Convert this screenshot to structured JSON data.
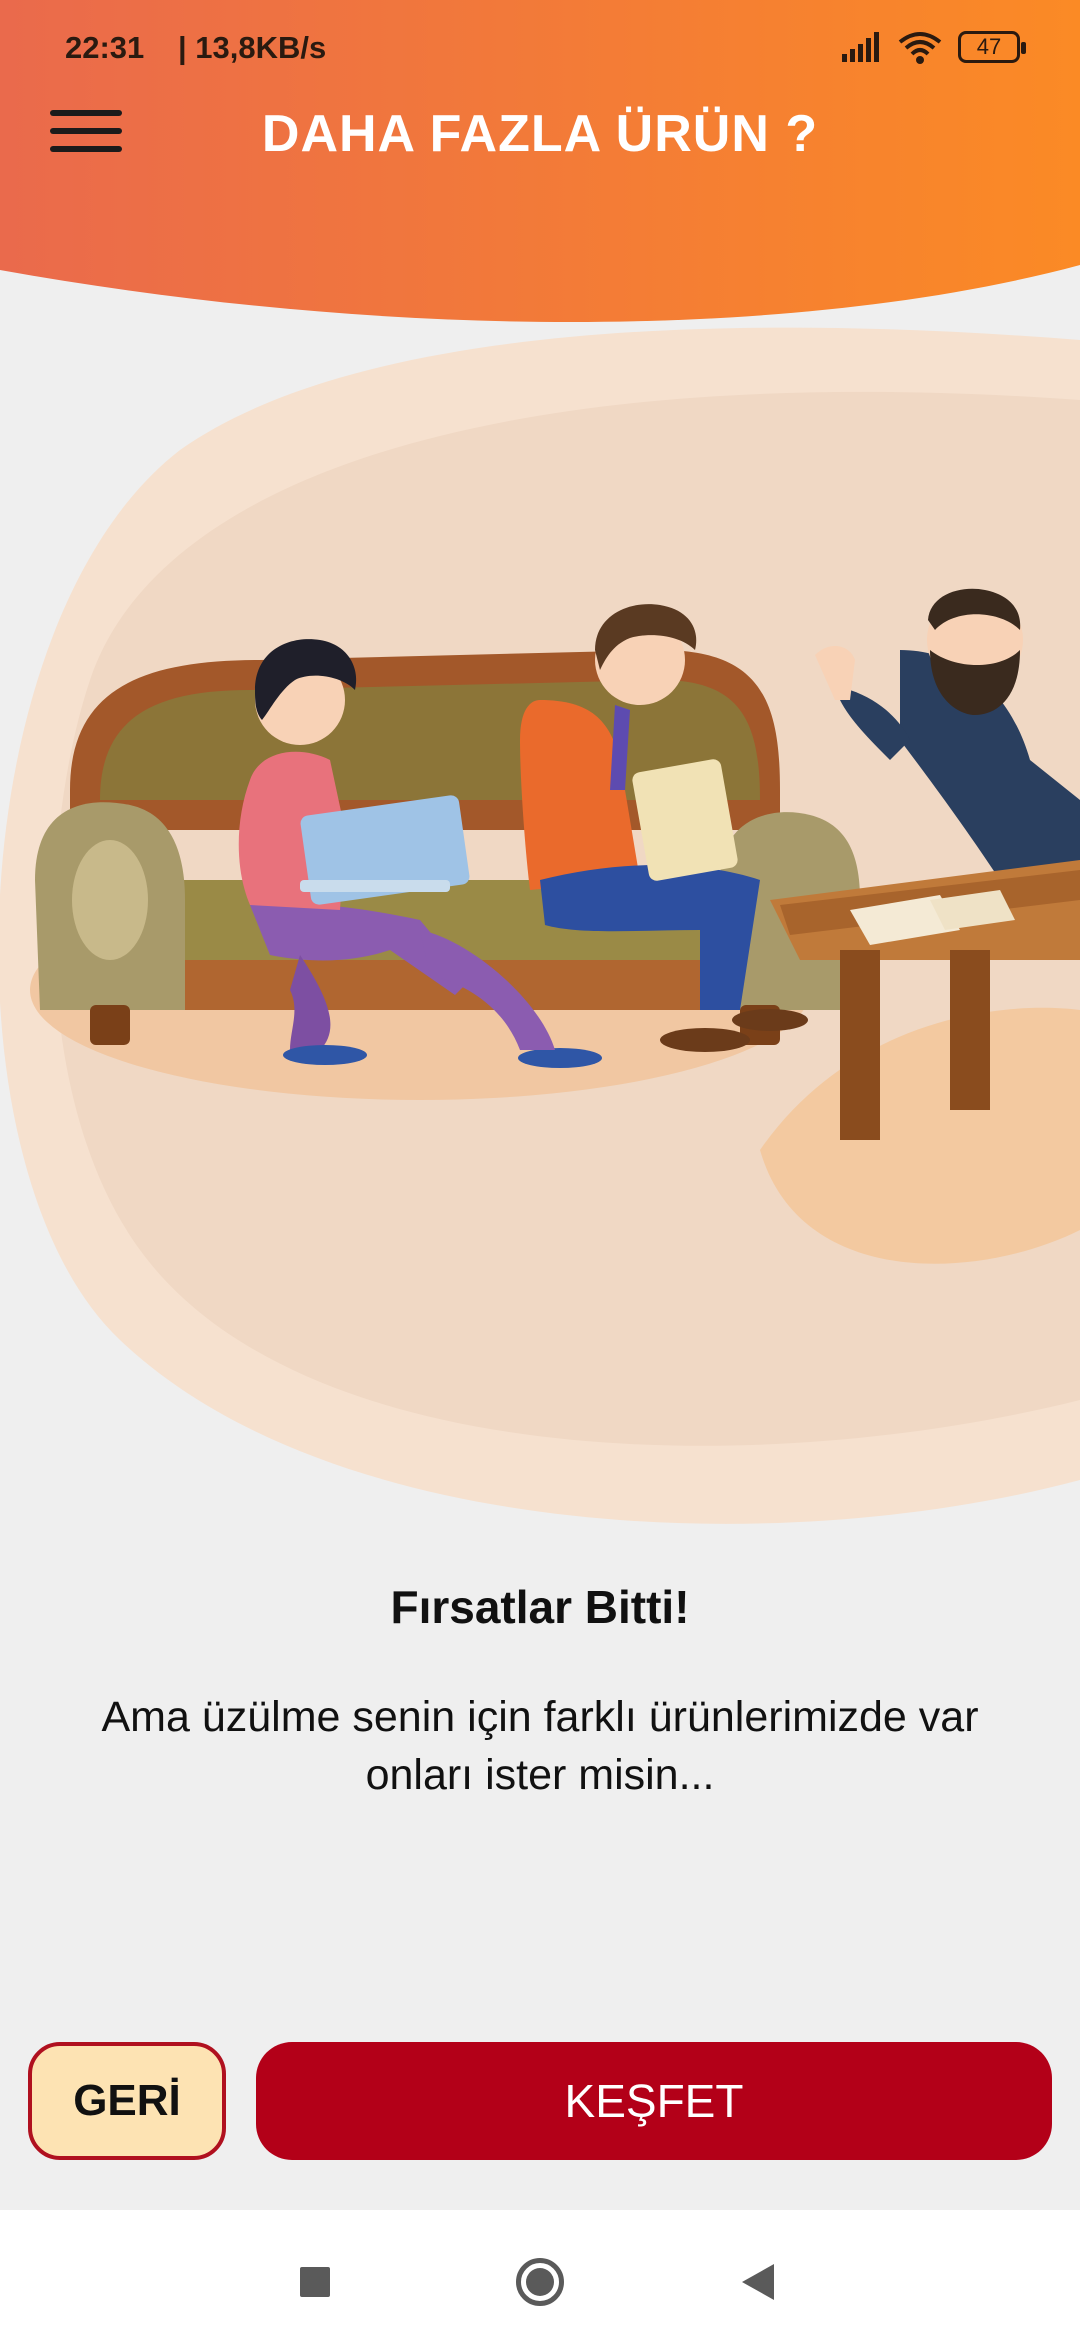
{
  "status_bar": {
    "time": "22:31",
    "speed": "| 13,8KB/s",
    "battery": "47",
    "signal_icon": "cell-signal-icon",
    "wifi_icon": "wifi-icon"
  },
  "header": {
    "title": "DAHA FAZLA ÜRÜN ?",
    "menu_icon": "hamburger-menu-icon",
    "gradient_start": "#ea6a4c",
    "gradient_end": "#fb8a25"
  },
  "content": {
    "headline": "Fırsatlar Bitti!",
    "message": "Ama üzülme senin için farklı ürünlerimizde var onları ister misin..."
  },
  "actions": {
    "back_label": "GERİ",
    "explore_label": "KEŞFET",
    "primary_color": "#b30018",
    "back_bg_color": "#fde3b3"
  },
  "nav": {
    "recents_icon": "square-recents-icon",
    "home_icon": "circle-home-icon",
    "back_icon": "triangle-back-icon"
  }
}
